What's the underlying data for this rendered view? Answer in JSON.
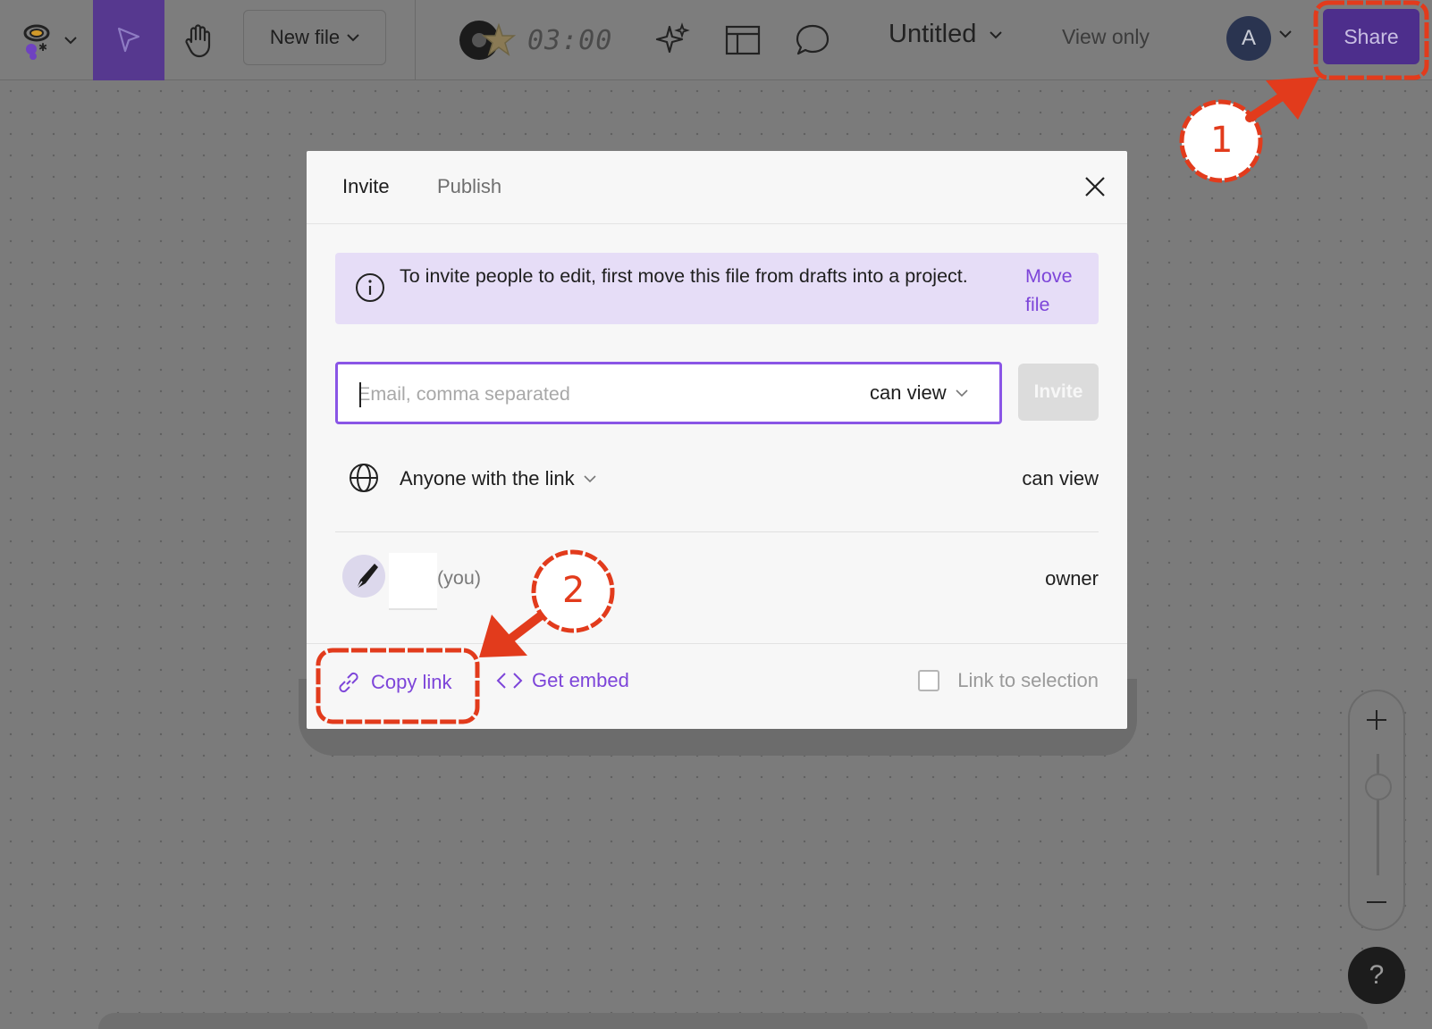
{
  "toolbar": {
    "new_file_label": "New file",
    "timer": "03:00",
    "file_title": "Untitled",
    "view_only": "View only",
    "avatar_initial": "A",
    "share_label": "Share",
    "icons": [
      "logo-icon",
      "chevron-down-icon",
      "cursor-icon",
      "hand-icon",
      "music-icon",
      "star-icon",
      "sparkle-icon",
      "layout-icon",
      "comment-icon"
    ]
  },
  "modal": {
    "tabs": [
      {
        "label": "Invite",
        "active": true
      },
      {
        "label": "Publish",
        "active": false
      }
    ],
    "notice": {
      "text": "To invite people to edit, first move this file from drafts into a project.",
      "link": "Move file"
    },
    "email": {
      "placeholder": "Email, comma separated",
      "value": "",
      "permission": "can view"
    },
    "invite_label": "Invite",
    "link_access": {
      "label": "Anyone with the link",
      "permission": "can view"
    },
    "people": [
      {
        "name": "",
        "suffix": "(you)",
        "role": "owner"
      }
    ],
    "footer": {
      "copy_link": "Copy link",
      "get_embed": "Get embed",
      "link_to_selection": "Link to selection",
      "link_to_selection_checked": false
    }
  },
  "zoom": {
    "plus": "+",
    "minus": "—"
  },
  "help_label": "?",
  "annotations": {
    "marker_1": "1",
    "marker_2": "2",
    "color": "#e23b1c"
  },
  "colors": {
    "accent": "#7d45d9",
    "share_bg": "#4d2e8c",
    "notice_bg": "#e6ddf7"
  }
}
